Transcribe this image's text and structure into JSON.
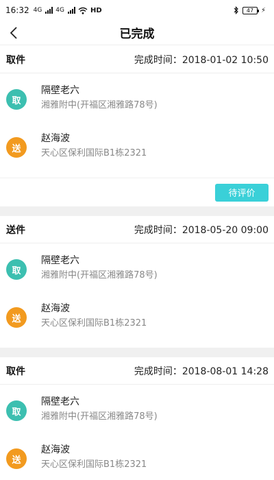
{
  "status_bar": {
    "time": "16:32",
    "signal1_label": "4G",
    "signal2_label": "4G",
    "network": "HD",
    "battery": "47",
    "bluetooth_icon": "bluetooth-icon",
    "charging_icon": "bolt-icon"
  },
  "nav": {
    "title": "已完成",
    "back_icon": "chevron-left-icon"
  },
  "colors": {
    "pickup_badge": "#3cbfb0",
    "deliver_badge": "#f29a1f",
    "action_button": "#3ad0d8"
  },
  "orders": [
    {
      "type": "取件",
      "time": "完成时间：2018-01-02 10:50",
      "pickup": {
        "badge": "取",
        "name": "隔壁老六",
        "addr": "湘雅附中(开福区湘雅路78号)"
      },
      "deliver": {
        "badge": "送",
        "name": "赵海波",
        "addr": "天心区保利国际B1栋2321"
      },
      "action": "待评价"
    },
    {
      "type": "送件",
      "time": "完成时间：2018-05-20 09:00",
      "pickup": {
        "badge": "取",
        "name": "隔壁老六",
        "addr": "湘雅附中(开福区湘雅路78号)"
      },
      "deliver": {
        "badge": "送",
        "name": "赵海波",
        "addr": "天心区保利国际B1栋2321"
      }
    },
    {
      "type": "取件",
      "time": "完成时间：2018-08-01 14:28",
      "pickup": {
        "badge": "取",
        "name": "隔壁老六",
        "addr": "湘雅附中(开福区湘雅路78号)"
      },
      "deliver": {
        "badge": "送",
        "name": "赵海波",
        "addr": "天心区保利国际B1栋2321"
      }
    }
  ]
}
